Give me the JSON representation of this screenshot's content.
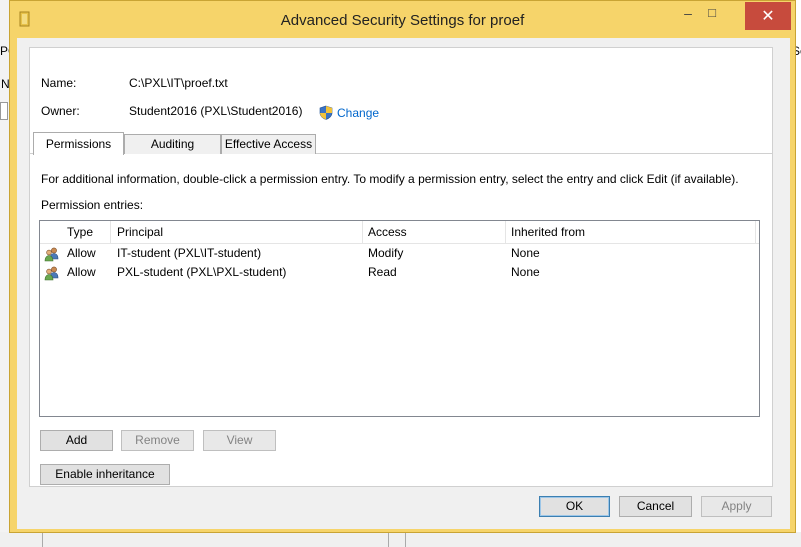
{
  "window": {
    "title": "Advanced Security Settings for proef",
    "close_glyph": "✕"
  },
  "background": {
    "frag1": "PC",
    "frag2": "N",
    "frag3": "Se"
  },
  "fields": {
    "name_label": "Name:",
    "name_value": "C:\\PXL\\IT\\proef.txt",
    "owner_label": "Owner:",
    "owner_value": "Student2016 (PXL\\Student2016)",
    "change_link": "Change"
  },
  "tabs": [
    {
      "label": "Permissions",
      "active": true
    },
    {
      "label": "Auditing",
      "active": false
    },
    {
      "label": "Effective Access",
      "active": false
    }
  ],
  "info_text": "For additional information, double-click a permission entry. To modify a permission entry, select the entry and click Edit (if available).",
  "permission_entries_label": "Permission entries:",
  "table": {
    "columns": [
      "Type",
      "Principal",
      "Access",
      "Inherited from"
    ],
    "rows": [
      {
        "type": "Allow",
        "principal": "IT-student (PXL\\IT-student)",
        "access": "Modify",
        "inherited": "None",
        "icon": "users-icon"
      },
      {
        "type": "Allow",
        "principal": "PXL-student (PXL\\PXL-student)",
        "access": "Read",
        "inherited": "None",
        "icon": "users-icon"
      }
    ]
  },
  "buttons": {
    "add": "Add",
    "remove": "Remove",
    "view": "View",
    "enable_inheritance": "Enable inheritance",
    "ok": "OK",
    "cancel": "Cancel",
    "apply": "Apply"
  },
  "colors": {
    "frame": "#f6d46a",
    "close": "#c74b3d",
    "link": "#0066cc"
  }
}
